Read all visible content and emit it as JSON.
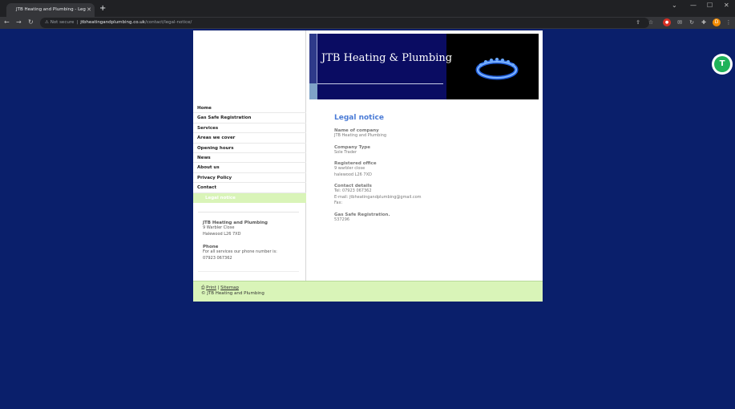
{
  "browser": {
    "tab_title": "JTB Heating and Plumbing - Leg",
    "new_tab": "+",
    "url_warning": "Not secure",
    "url_host": "jtbheatingandplumbing.co.uk",
    "url_path": "/contact/legal-notice/",
    "profile_initial": "D"
  },
  "site": {
    "banner_title": "JTB Heating & Plumbing",
    "nav": [
      "Home",
      "Gas Safe Registration",
      "Services",
      "Areas we cover",
      "Opening hours",
      "News",
      "About us",
      "Privacy Policy",
      "Contact"
    ],
    "nav_sub": "Legal notice",
    "sidebar": {
      "company": "JTB Heating and Plumbing",
      "address1": "9 Warbler Close",
      "address2": "Halewood L26 7XD",
      "phone_heading": "Phone",
      "phone_text": "For all services our phone number is:",
      "phone": "07923 067362"
    },
    "main": {
      "heading": "Legal notice",
      "name_label": "Name of company",
      "name_value": "JTB Heating and Plumbing",
      "type_label": "Company Type",
      "type_value": "Sole Trader",
      "office_label": "Registered office",
      "office_line1": "9 warbler close",
      "office_line2": "halewood L26 7XD",
      "contact_label": "Contact details",
      "contact_tel": "Tel: 07923 067362",
      "contact_email": "E-mail: jtbheatingandplumbing@gmail.com",
      "contact_fax": "Fax:",
      "gas_label": "Gas Safe Registration.",
      "gas_value": "537296"
    },
    "footer": {
      "print": "Print",
      "separator": "|",
      "sitemap": "Sitemap",
      "copyright": "© JTB Heating and Plumbing"
    }
  },
  "floating_avatar": "T"
}
